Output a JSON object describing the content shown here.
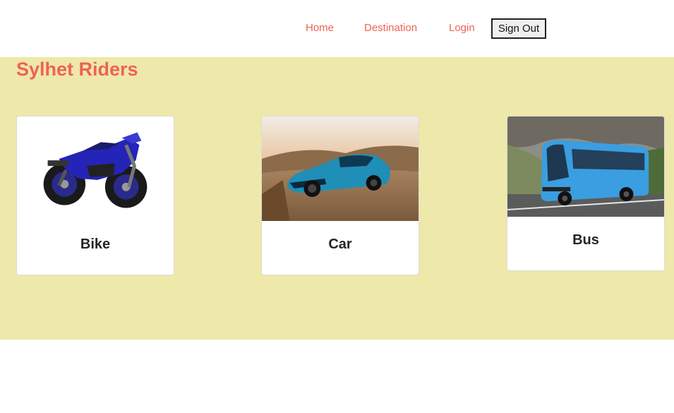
{
  "nav": {
    "home_label": "Home",
    "destination_label": "Destination",
    "login_label": "Login",
    "signout_label": "Sign Out"
  },
  "hero": {
    "brand": "Sylhet Riders"
  },
  "cards": [
    {
      "title": "Bike",
      "icon": "motorcycle-photo"
    },
    {
      "title": "Car",
      "icon": "sports-car-photo"
    },
    {
      "title": "Bus",
      "icon": "bus-photo"
    }
  ],
  "colors": {
    "accent": "#ee6352",
    "hero_background": "#eee8aa",
    "card_background": "#ffffff"
  }
}
